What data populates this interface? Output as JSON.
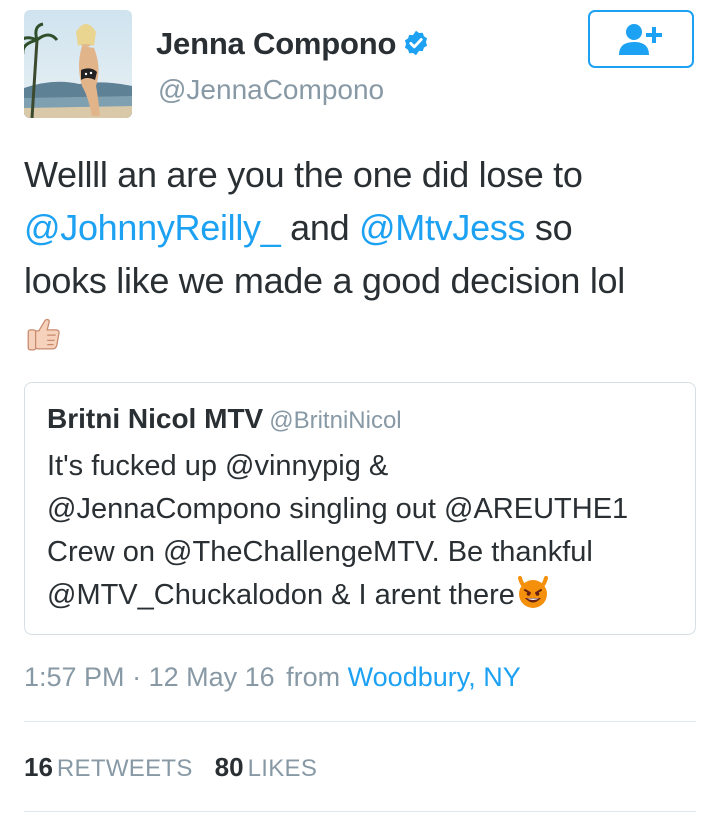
{
  "author": {
    "name": "Jenna Compono",
    "handle": "@JennaCompono",
    "verified": true
  },
  "follow_button": {
    "icon": "follow-user-plus-icon"
  },
  "tweet": {
    "line1": "Wellll an are you the one did lose to",
    "mention1": "@JohnnyReilly_",
    "and": " and ",
    "mention2": "@MtvJess",
    "line2_tail": " so",
    "line3": "looks like we made a good decision lol",
    "emoji": "thumbs-up-icon"
  },
  "quoted_tweet": {
    "author_name": "Britni Nicol MTV",
    "author_handle": "@BritniNicol",
    "lines": [
      "It's fucked up @vinnypig &",
      "@JennaCompono singling out @AREUTHE1",
      "Crew on @TheChallengeMTV. Be thankful",
      "@MTV_Chuckalodon & I arent there"
    ],
    "emoji": "smiling-devil-icon"
  },
  "meta": {
    "time": "1:57 PM",
    "sep": " · ",
    "date": "12 May 16",
    "from": "from",
    "place": "Woodbury, NY"
  },
  "stats": {
    "retweets_count": "16",
    "retweets_label": "RETWEETS",
    "likes_count": "80",
    "likes_label": "LIKES"
  },
  "colors": {
    "accent": "#1da1f2",
    "muted": "#8899a6",
    "text": "#292f33",
    "border": "#e1e8ed"
  }
}
